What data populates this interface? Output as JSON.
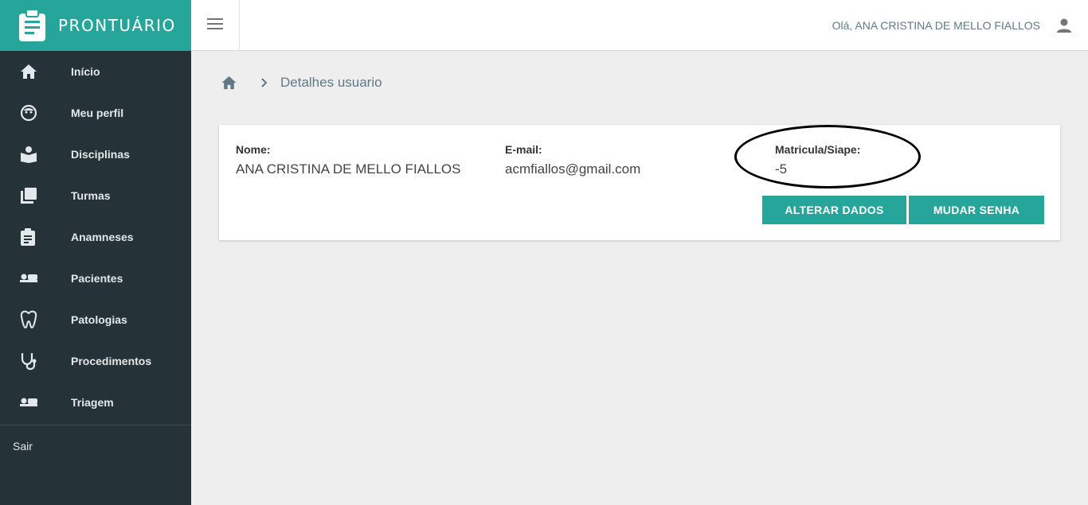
{
  "brand": {
    "title": "PRONTUÁRIO",
    "icon": "clipboard-icon"
  },
  "sidebar": {
    "items": [
      {
        "label": "Início",
        "icon": "home-icon"
      },
      {
        "label": "Meu perfil",
        "icon": "face-icon"
      },
      {
        "label": "Disciplinas",
        "icon": "book-reader-icon"
      },
      {
        "label": "Turmas",
        "icon": "library-books-icon"
      },
      {
        "label": "Anamneses",
        "icon": "clipboard-text-icon"
      },
      {
        "label": "Pacientes",
        "icon": "hotel-bed-icon"
      },
      {
        "label": "Patologias",
        "icon": "tooth-icon"
      },
      {
        "label": "Procedimentos",
        "icon": "stethoscope-icon"
      },
      {
        "label": "Triagem",
        "icon": "hotel-bed-icon"
      }
    ],
    "logout_label": "Sair"
  },
  "header": {
    "greeting": "Olá, ANA CRISTINA DE MELLO FIALLOS",
    "menu_icon": "hamburger-menu-icon",
    "user_icon": "account-icon"
  },
  "breadcrumb": {
    "current": "Detalhes usuario"
  },
  "user": {
    "nome_label": "Nome:",
    "nome": "ANA CRISTINA DE MELLO FIALLOS",
    "email_label": "E-mail:",
    "email": "acmfiallos@gmail.com",
    "matricula_label": "Matricula/Siape:",
    "matricula": "-5"
  },
  "actions": {
    "alterar": "ALTERAR DADOS",
    "senha": "MUDAR SENHA"
  },
  "colors": {
    "accent": "#26a69a",
    "sidebar": "#253238",
    "background": "#eeeeee"
  }
}
